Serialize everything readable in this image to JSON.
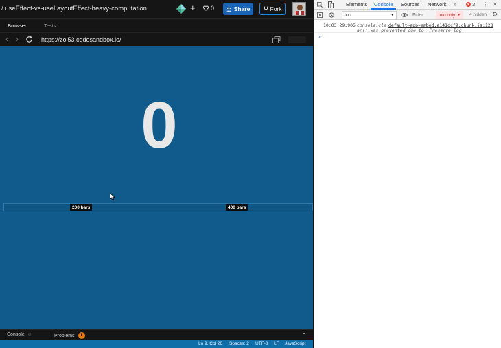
{
  "sandbox": {
    "title": "/ useEffect-vs-useLayoutEffect-heavy-computation",
    "likes_count": "0",
    "share_label": "Share",
    "fork_label": "Fork"
  },
  "preview_tabs": [
    {
      "label": "Browser",
      "active": true
    },
    {
      "label": "Tests",
      "active": false
    }
  ],
  "navigation": {
    "url": "https://zoi53.codesandbox.io/"
  },
  "preview": {
    "count": "0",
    "bars": [
      {
        "label": "200 bars"
      },
      {
        "label": "400 bars"
      }
    ],
    "background": "#105b8b"
  },
  "bottom_panel": {
    "console_label": "Console",
    "problems_label": "Problems",
    "problems_count": "1"
  },
  "status_bar": {
    "position": "Ln 9, Col 26",
    "spaces": "Spaces: 2",
    "encoding": "UTF-8",
    "eol": "LF",
    "language": "JavaScript"
  },
  "devtools": {
    "tabs": [
      {
        "label": "Elements",
        "active": false
      },
      {
        "label": "Console",
        "active": true
      },
      {
        "label": "Sources",
        "active": false
      },
      {
        "label": "Network",
        "active": false
      }
    ],
    "error_count": "3",
    "context": "top",
    "filter_placeholder": "Filter",
    "levels_label": "Info only",
    "hidden_count": "4 hidden",
    "log": {
      "timestamp": "10:03:29.905",
      "message": "console.cle",
      "source": "default~app~embed.e141dcf9.chunk.js:128",
      "message_cont": "ar() was prevented due to 'Preserve log'"
    },
    "prompt_symbol": "›"
  },
  "colors": {
    "accent": "#1a64b8",
    "status_bar": "#0f6ea7",
    "warning": "#e07b1a",
    "error": "#e53935"
  }
}
